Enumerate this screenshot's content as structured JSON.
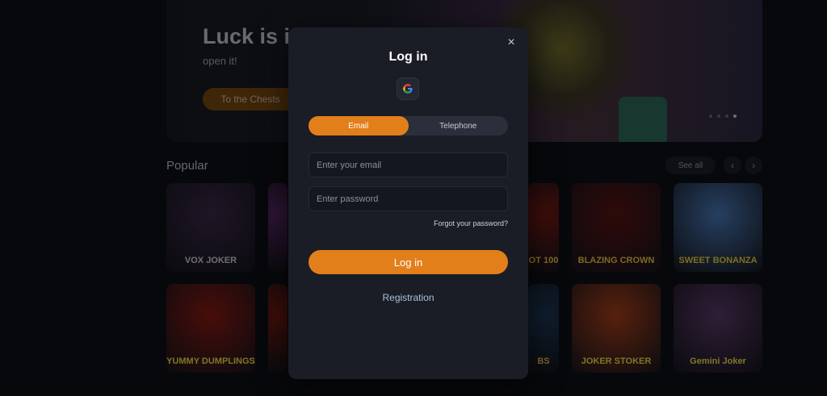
{
  "hero": {
    "title": "Luck is i",
    "subtitle": "open it!",
    "button": "To the Chests"
  },
  "popular": {
    "heading": "Popular",
    "see_all": "See all",
    "prev": "‹",
    "next": "›"
  },
  "games": [
    {
      "title": "VOX JOKER",
      "color": "#3b2a4a",
      "text_color": "#d9d6e0"
    },
    {
      "title": "",
      "color": "#5a2a6a",
      "text_color": "#e8c45a"
    },
    {
      "title": "OT 100",
      "color": "#7a1a14",
      "text_color": "#f2c84b"
    },
    {
      "title": "BLAZING CROWN",
      "color": "#5a1414",
      "text_color": "#f2c84b"
    },
    {
      "title": "SWEET BONANZA",
      "color": "#4a7ab8",
      "text_color": "#f4d23a"
    },
    {
      "title": "YUMMY DUMPLINGS",
      "color": "#8a1a14",
      "text_color": "#f2e04b"
    },
    {
      "title": "",
      "color": "#7a1a14",
      "text_color": "#f2c84b"
    },
    {
      "title": "BS",
      "color": "#1e3a5a",
      "text_color": "#e8c45a"
    },
    {
      "title": "JOKER STOKER",
      "color": "#a8401a",
      "text_color": "#f2e04b"
    },
    {
      "title": "Gemini Joker",
      "color": "#5a3a6a",
      "text_color": "#f2e04b"
    }
  ],
  "modal": {
    "title": "Log in",
    "close": "×",
    "google_letter": "G",
    "tabs": [
      {
        "label": "Email",
        "active": true
      },
      {
        "label": "Telephone",
        "active": false
      }
    ],
    "email_placeholder": "Enter your email",
    "password_placeholder": "Enter password",
    "forgot": "Forgot your password?",
    "login_button": "Log in",
    "register": "Registration"
  },
  "colors": {
    "accent": "#e27f1b",
    "modal_bg": "#1a1d26",
    "page_bg": "#0e1016"
  }
}
